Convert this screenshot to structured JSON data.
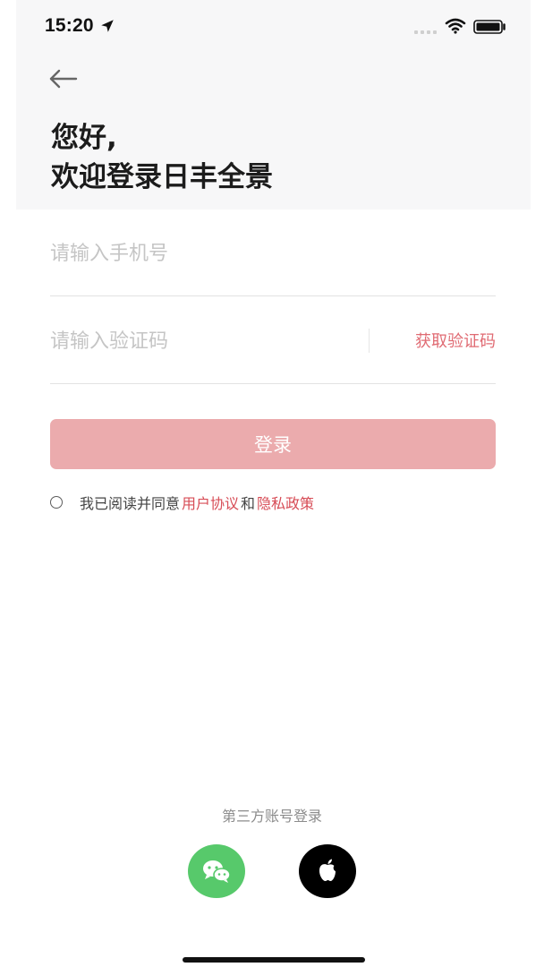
{
  "status_bar": {
    "time": "15:20"
  },
  "header": {
    "greeting_line1": "您好,",
    "greeting_line2": "欢迎登录日丰全景"
  },
  "form": {
    "phone_placeholder": "请输入手机号",
    "code_placeholder": "请输入验证码",
    "get_code_label": "获取验证码",
    "login_label": "登录"
  },
  "agreement": {
    "prefix": "我已阅读并同意",
    "user_agreement": "用户协议",
    "and": "和",
    "privacy_policy": "隐私政策"
  },
  "third_party": {
    "label": "第三方账号登录"
  },
  "icons": {
    "back": "back-arrow-icon",
    "location": "location-arrow-icon",
    "cell": "cellular-signal-icon",
    "wifi": "wifi-icon",
    "battery": "battery-icon",
    "wechat": "wechat-icon",
    "apple": "apple-icon"
  },
  "colors": {
    "accent": "#d74c56",
    "login_button": "#ebabad",
    "wechat": "#57c96b",
    "apple": "#000000",
    "top_background": "#f7f7f8"
  }
}
